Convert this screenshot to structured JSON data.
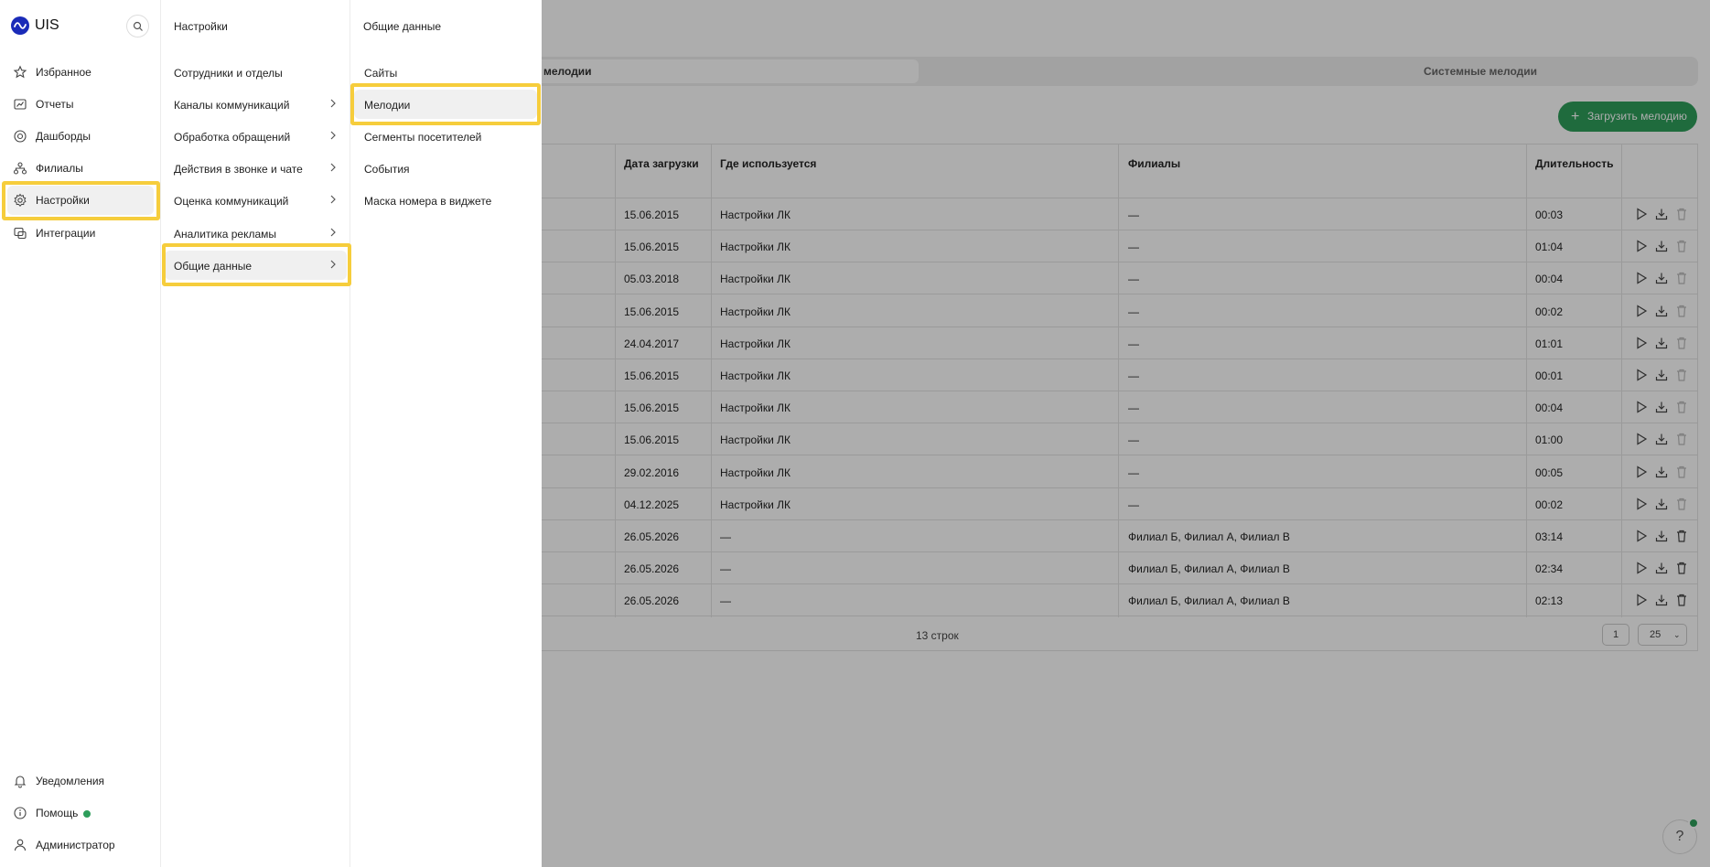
{
  "app": {
    "logo_text": "UIS"
  },
  "sidebar": {
    "items": [
      {
        "label": "Избранное",
        "icon": "star-icon"
      },
      {
        "label": "Отчеты",
        "icon": "reports-icon"
      },
      {
        "label": "Дашборды",
        "icon": "dashboard-icon"
      },
      {
        "label": "Филиалы",
        "icon": "branches-icon"
      },
      {
        "label": "Настройки",
        "icon": "gear-icon",
        "active": true
      },
      {
        "label": "Интеграции",
        "icon": "integrations-icon"
      }
    ],
    "bottom": [
      {
        "label": "Уведомления",
        "icon": "bell-icon"
      },
      {
        "label": "Помощь",
        "icon": "info-icon",
        "status_dot": "online"
      },
      {
        "label": "Администратор",
        "icon": "user-icon"
      }
    ]
  },
  "settings_menu": {
    "title": "Настройки",
    "items": [
      {
        "label": "Сотрудники и отделы",
        "has_submenu": false
      },
      {
        "label": "Каналы коммуникаций",
        "has_submenu": true
      },
      {
        "label": "Обработка обращений",
        "has_submenu": true
      },
      {
        "label": "Действия в звонке и чате",
        "has_submenu": true
      },
      {
        "label": "Оценка коммуникаций",
        "has_submenu": true
      },
      {
        "label": "Аналитика рекламы",
        "has_submenu": true
      },
      {
        "label": "Общие данные",
        "has_submenu": true,
        "active": true
      }
    ]
  },
  "general_menu": {
    "title": "Общие данные",
    "items": [
      {
        "label": "Сайты"
      },
      {
        "label": "Мелодии",
        "active": true
      },
      {
        "label": "Сегменты посетителей"
      },
      {
        "label": "События"
      },
      {
        "label": "Маска номера в виджете"
      }
    ]
  },
  "page": {
    "tabs": [
      {
        "label": "мелодии",
        "active": true
      },
      {
        "label": "Системные мелодии"
      }
    ],
    "upload_button": "Загрузить мелодию",
    "table": {
      "columns": [
        "Дата загрузки",
        "Где используется",
        "Филиалы",
        "Длительность"
      ],
      "rows": [
        {
          "date": "15.06.2015",
          "used": "Настройки ЛК",
          "branches": "—",
          "duration": "00:03",
          "deletable": false
        },
        {
          "date": "15.06.2015",
          "used": "Настройки ЛК",
          "branches": "—",
          "duration": "01:04",
          "deletable": false
        },
        {
          "date": "05.03.2018",
          "used": "Настройки ЛК",
          "branches": "—",
          "duration": "00:04",
          "deletable": false
        },
        {
          "date": "15.06.2015",
          "used": "Настройки ЛК",
          "branches": "—",
          "duration": "00:02",
          "deletable": false
        },
        {
          "date": "24.04.2017",
          "used": "Настройки ЛК",
          "branches": "—",
          "duration": "01:01",
          "deletable": false
        },
        {
          "date": "15.06.2015",
          "used": "Настройки ЛК",
          "branches": "—",
          "duration": "00:01",
          "deletable": false
        },
        {
          "date": "15.06.2015",
          "used": "Настройки ЛК",
          "branches": "—",
          "duration": "00:04",
          "deletable": false
        },
        {
          "date": "15.06.2015",
          "used": "Настройки ЛК",
          "branches": "—",
          "duration": "01:00",
          "deletable": false
        },
        {
          "date": "29.02.2016",
          "used": "Настройки ЛК",
          "branches": "—",
          "duration": "00:05",
          "deletable": false
        },
        {
          "date": "04.12.2025",
          "used": "Настройки ЛК",
          "branches": "—",
          "duration": "00:02",
          "deletable": false
        },
        {
          "date": "26.05.2026",
          "used": "—",
          "branches": "Филиал Б, Филиал А, Филиал В",
          "duration": "03:14",
          "deletable": true
        },
        {
          "date": "26.05.2026",
          "used": "—",
          "branches": "Филиал Б, Филиал А, Филиал В",
          "duration": "02:34",
          "deletable": true
        },
        {
          "date": "26.05.2026",
          "used": "—",
          "branches": "Филиал Б, Филиал А, Филиал В",
          "duration": "02:13",
          "deletable": true
        }
      ],
      "row_count": "13 строк",
      "page": "1",
      "per_page": "25"
    },
    "help_fab": "?"
  },
  "colors": {
    "accent_green": "#2e9e5b",
    "highlight": "#f6cd3c",
    "brand_blue": "#1a2bb8"
  }
}
